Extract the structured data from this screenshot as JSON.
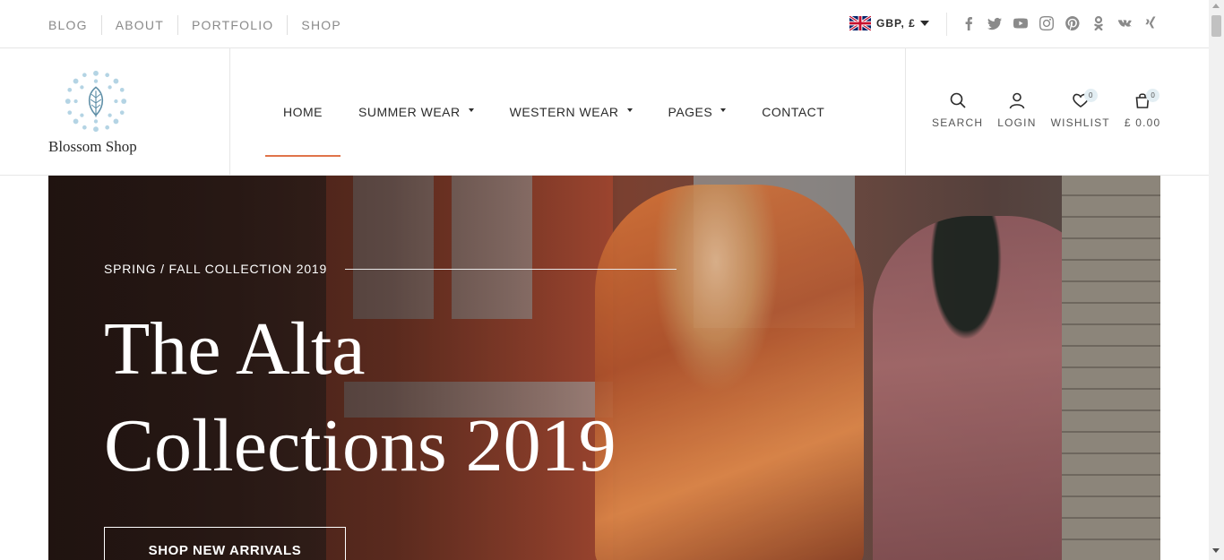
{
  "topbar": {
    "links": [
      "BLOG",
      "ABOUT",
      "PORTFOLIO",
      "SHOP"
    ],
    "currency": "GBP, £",
    "flag_icon": "uk-flag-icon",
    "socials": [
      "facebook-icon",
      "twitter-icon",
      "youtube-icon",
      "instagram-icon",
      "pinterest-icon",
      "odnoklassniki-icon",
      "vk-icon",
      "xing-icon"
    ]
  },
  "logo": {
    "text": "Blossom Shop"
  },
  "nav": {
    "items": [
      {
        "label": "HOME",
        "active": true,
        "dropdown": false
      },
      {
        "label": "SUMMER WEAR",
        "active": false,
        "dropdown": true
      },
      {
        "label": "WESTERN WEAR",
        "active": false,
        "dropdown": true
      },
      {
        "label": "PAGES",
        "active": false,
        "dropdown": true
      },
      {
        "label": "CONTACT",
        "active": false,
        "dropdown": false
      }
    ]
  },
  "header_icons": {
    "search": "SEARCH",
    "login": "LOGIN",
    "wishlist": "WISHLIST",
    "wishlist_count": "0",
    "cart": "£ 0.00",
    "cart_count": "0"
  },
  "hero": {
    "kicker": "SPRING / FALL COLLECTION 2019",
    "title_line1": "The Alta",
    "title_line2": "Collections 2019",
    "cta": "SHOP NEW ARRIVALS"
  },
  "colors": {
    "accent": "#e0744a",
    "text": "#2b2b2b",
    "muted": "#8a8a8a",
    "badge_bg": "#e3eef3"
  }
}
